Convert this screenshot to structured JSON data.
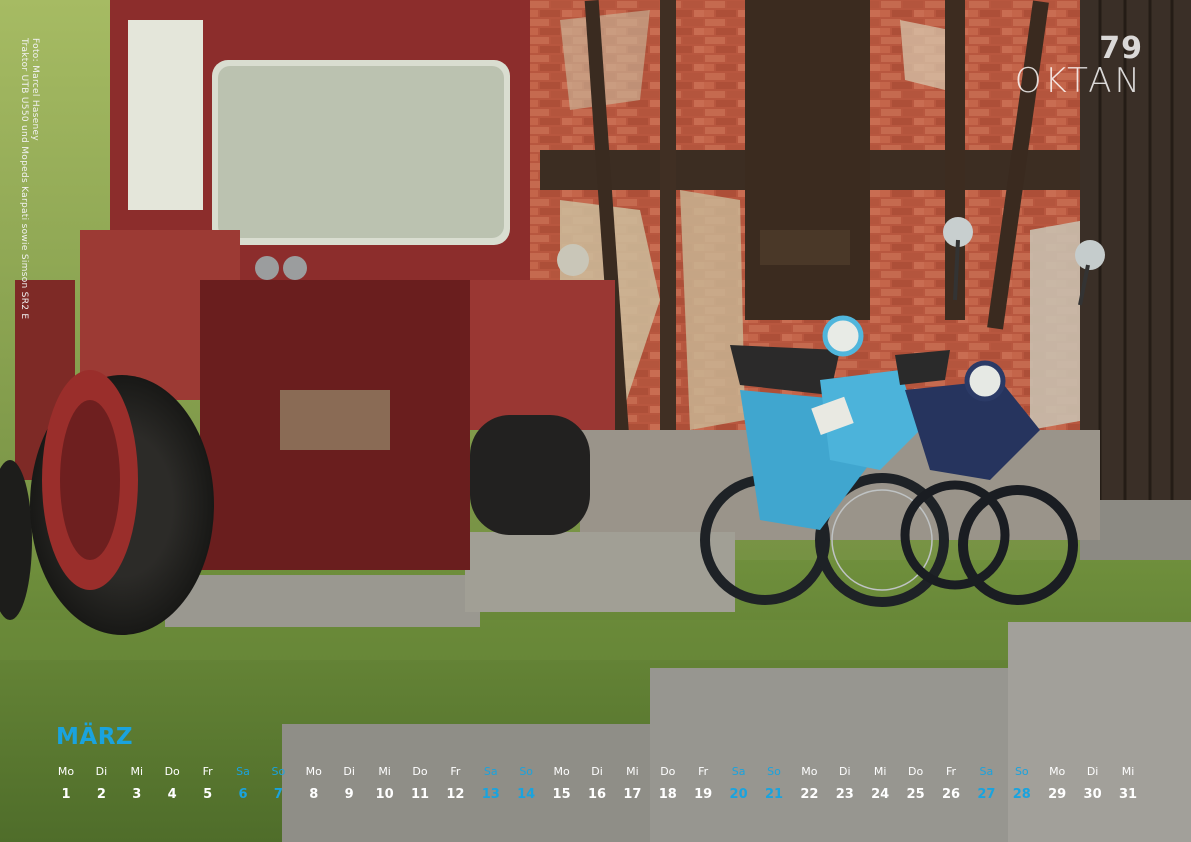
{
  "photo_credit": "Foto: Marcel Haseney\nTraktor UTB U550 und Mopeds Karpati sowie Simson SR2 E",
  "brand": {
    "number": "79",
    "name": "OKTAN"
  },
  "colors": {
    "accent": "#1aa3de",
    "text": "#ffffff"
  },
  "month": "MÄRZ",
  "days": [
    {
      "wd": "Mo",
      "d": "1",
      "we": false
    },
    {
      "wd": "Di",
      "d": "2",
      "we": false
    },
    {
      "wd": "Mi",
      "d": "3",
      "we": false
    },
    {
      "wd": "Do",
      "d": "4",
      "we": false
    },
    {
      "wd": "Fr",
      "d": "5",
      "we": false
    },
    {
      "wd": "Sa",
      "d": "6",
      "we": true
    },
    {
      "wd": "So",
      "d": "7",
      "we": true
    },
    {
      "wd": "Mo",
      "d": "8",
      "we": false
    },
    {
      "wd": "Di",
      "d": "9",
      "we": false
    },
    {
      "wd": "Mi",
      "d": "10",
      "we": false
    },
    {
      "wd": "Do",
      "d": "11",
      "we": false
    },
    {
      "wd": "Fr",
      "d": "12",
      "we": false
    },
    {
      "wd": "Sa",
      "d": "13",
      "we": true
    },
    {
      "wd": "So",
      "d": "14",
      "we": true
    },
    {
      "wd": "Mo",
      "d": "15",
      "we": false
    },
    {
      "wd": "Di",
      "d": "16",
      "we": false
    },
    {
      "wd": "Mi",
      "d": "17",
      "we": false
    },
    {
      "wd": "Do",
      "d": "18",
      "we": false
    },
    {
      "wd": "Fr",
      "d": "19",
      "we": false
    },
    {
      "wd": "Sa",
      "d": "20",
      "we": true
    },
    {
      "wd": "So",
      "d": "21",
      "we": true
    },
    {
      "wd": "Mo",
      "d": "22",
      "we": false
    },
    {
      "wd": "Di",
      "d": "23",
      "we": false
    },
    {
      "wd": "Mi",
      "d": "24",
      "we": false
    },
    {
      "wd": "Do",
      "d": "25",
      "we": false
    },
    {
      "wd": "Fr",
      "d": "26",
      "we": false
    },
    {
      "wd": "Sa",
      "d": "27",
      "we": true
    },
    {
      "wd": "So",
      "d": "28",
      "we": true
    },
    {
      "wd": "Mo",
      "d": "29",
      "we": false
    },
    {
      "wd": "Di",
      "d": "30",
      "we": false
    },
    {
      "wd": "Mi",
      "d": "31",
      "we": false
    }
  ]
}
